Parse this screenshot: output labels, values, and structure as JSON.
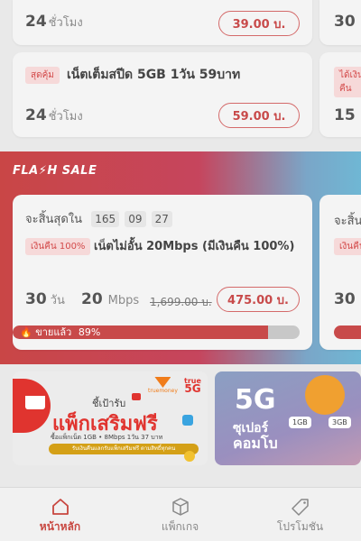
{
  "packages": [
    {
      "badge": "",
      "title": "",
      "duration_num": "24",
      "duration_unit": "ชั่วโมง",
      "price": "39.00 บ."
    },
    {
      "badge": "สุดคุ้ม",
      "title": "เน็ตเต็มสปีด 5GB 1วัน 59บาท",
      "duration_num": "24",
      "duration_unit": "ชั่วโมง",
      "price": "59.00 บ."
    }
  ],
  "right_partial": {
    "top_num": "30",
    "badge": "ได้เงินคืน",
    "num": "15"
  },
  "flash_sale": {
    "title": "FLA⚡H SALE",
    "countdown_label": "จะสิ้นสุดใน",
    "countdown": [
      "165",
      "09",
      "27"
    ],
    "badge": "เงินคืน 100%",
    "title_text": "เน็ตไม่อั้น 20Mbps (มีเงินคืน 100%)",
    "days_num": "30",
    "days_unit": "วัน",
    "speed_num": "20",
    "speed_unit": "Mbps",
    "old_price": "1,699.00 บ.",
    "price": "475.00 บ.",
    "sold_label": "ขายแล้ว",
    "sold_percent": "89%",
    "sold_fraction": 0.89,
    "next_countdown_label": "จะสิ้น",
    "next_badge": "เงินคืน",
    "next_days_num": "30"
  },
  "banners": {
    "b1_small": "ชี้เป้ารับ",
    "b1_big": "แพ็กเสริมฟรี",
    "b1_sub": "ซื้อแพ็กเน็ต 1GB • 8Mbps 1วัน 37 บาท",
    "b1_strip": "รับเงินคืนแลกรับแพ็กเสริมฟรี ตามสิทธิ์ทุกคน",
    "b1_brand": "truemoney",
    "b1_true": "true",
    "b1_5g": "5G",
    "b2_big": "5G",
    "b2_text1": "ซุเปอร์",
    "b2_text2": "คอมโบ",
    "b2_tag1": "1GB",
    "b2_tag2": "3GB"
  },
  "bottom_nav": [
    {
      "label": "หน้าหลัก",
      "icon": "home-icon"
    },
    {
      "label": "แพ็กเกจ",
      "icon": "package-icon"
    },
    {
      "label": "โปรโมชัน",
      "icon": "tag-icon"
    }
  ],
  "colors": {
    "accent": "#c84a4a",
    "active_nav": "#c8463f"
  }
}
